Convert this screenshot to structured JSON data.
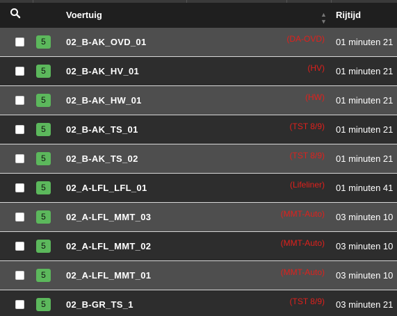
{
  "header": {
    "vehicle_label": "Voertuig",
    "time_label": "Rijtijd",
    "search_icon": "search-icon",
    "sort_icon": "sort-icon"
  },
  "colors": {
    "badge": "#5cb85c",
    "type_text": "#e0201c",
    "row_odd": "#4e4e4e",
    "row_even": "#2d2d2d"
  },
  "rows": [
    {
      "status": "5",
      "vehicle": "02_B-AK_OVD_01",
      "type": "(DA-OVD)",
      "time": "01 minuten 21"
    },
    {
      "status": "5",
      "vehicle": "02_B-AK_HV_01",
      "type": "(HV)",
      "time": "01 minuten 21"
    },
    {
      "status": "5",
      "vehicle": "02_B-AK_HW_01",
      "type": "(HW)",
      "time": "01 minuten 21"
    },
    {
      "status": "5",
      "vehicle": "02_B-AK_TS_01",
      "type": "(TST 8/9)",
      "time": "01 minuten 21"
    },
    {
      "status": "5",
      "vehicle": "02_B-AK_TS_02",
      "type": "(TST 8/9)",
      "time": "01 minuten 21"
    },
    {
      "status": "5",
      "vehicle": "02_A-LFL_LFL_01",
      "type": "(Lifeliner)",
      "time": "01 minuten 41"
    },
    {
      "status": "5",
      "vehicle": "02_A-LFL_MMT_03",
      "type": "(MMT-Auto)",
      "time": "03 minuten 10"
    },
    {
      "status": "5",
      "vehicle": "02_A-LFL_MMT_02",
      "type": "(MMT-Auto)",
      "time": "03 minuten 10"
    },
    {
      "status": "5",
      "vehicle": "02_A-LFL_MMT_01",
      "type": "(MMT-Auto)",
      "time": "03 minuten 10"
    },
    {
      "status": "5",
      "vehicle": "02_B-GR_TS_1",
      "type": "(TST 8/9)",
      "time": "03 minuten 21"
    }
  ]
}
